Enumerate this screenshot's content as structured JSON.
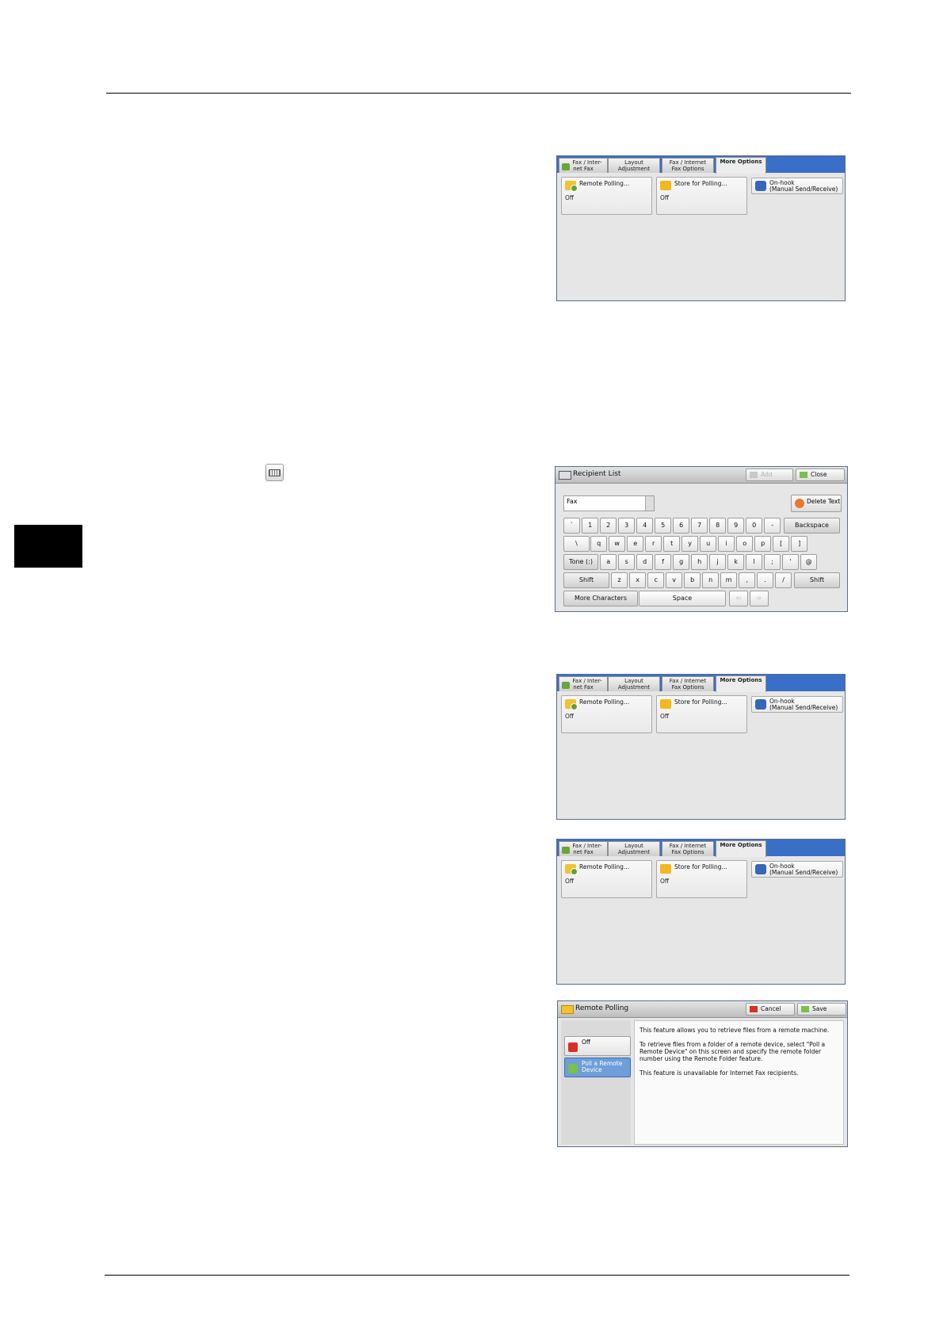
{
  "keyboard_icon": "keyboard-icon",
  "fax_screen": {
    "tabs": [
      {
        "label": "Fax / Inter-\nnet Fax",
        "icon": "fax-tab-icon"
      },
      {
        "label": "Layout\nAdjustment"
      },
      {
        "label": "Fax / Internet\nFax Options"
      },
      {
        "label": "More Options"
      }
    ],
    "remote_polling": {
      "label": "Remote Polling...",
      "value": "Off"
    },
    "store_for_polling": {
      "label": "Store for Polling...",
      "value": "Off"
    },
    "on_hook": {
      "label": "On-hook\n(Manual Send/Receive)"
    }
  },
  "recipient_list": {
    "title": "Recipient List",
    "add_label": "Add",
    "close_label": "Close",
    "select_value": "Fax",
    "delete_label": "Delete Text",
    "rows": [
      [
        "`",
        "1",
        "2",
        "3",
        "4",
        "5",
        "6",
        "7",
        "8",
        "9",
        "0",
        "-"
      ],
      [
        "\\",
        "q",
        "w",
        "e",
        "r",
        "t",
        "y",
        "u",
        "i",
        "o",
        "p",
        "[",
        "]"
      ],
      [
        "a",
        "s",
        "d",
        "f",
        "g",
        "h",
        "j",
        "k",
        "l",
        ";",
        "'",
        "@"
      ],
      [
        "z",
        "x",
        "c",
        "v",
        "b",
        "n",
        "m",
        ",",
        ".",
        "/"
      ]
    ],
    "backspace_label": "Backspace",
    "tone_label": "Tone (:)",
    "shift_label": "Shift",
    "more_chars_label": "More Characters",
    "space_label": "Space",
    "left_arrow": "⇦",
    "right_arrow": "⇨"
  },
  "remote_polling_screen": {
    "title": "Remote Polling",
    "cancel_label": "Cancel",
    "save_label": "Save",
    "off_label": "Off",
    "poll_label": "Poll a Remote\nDevice",
    "desc1": "This feature allows you to retrieve files from a remote machine.",
    "desc2": "To retrieve files from a folder of a remote device, select \"Poll a Remote Device\" on this screen and specify the remote folder number using the Remote Folder feature.",
    "desc3": "This feature is unavailable for Internet Fax recipients."
  },
  "colors": {
    "tab_bar": "#3a6fc7",
    "selected_option": "#6f9ed8"
  }
}
